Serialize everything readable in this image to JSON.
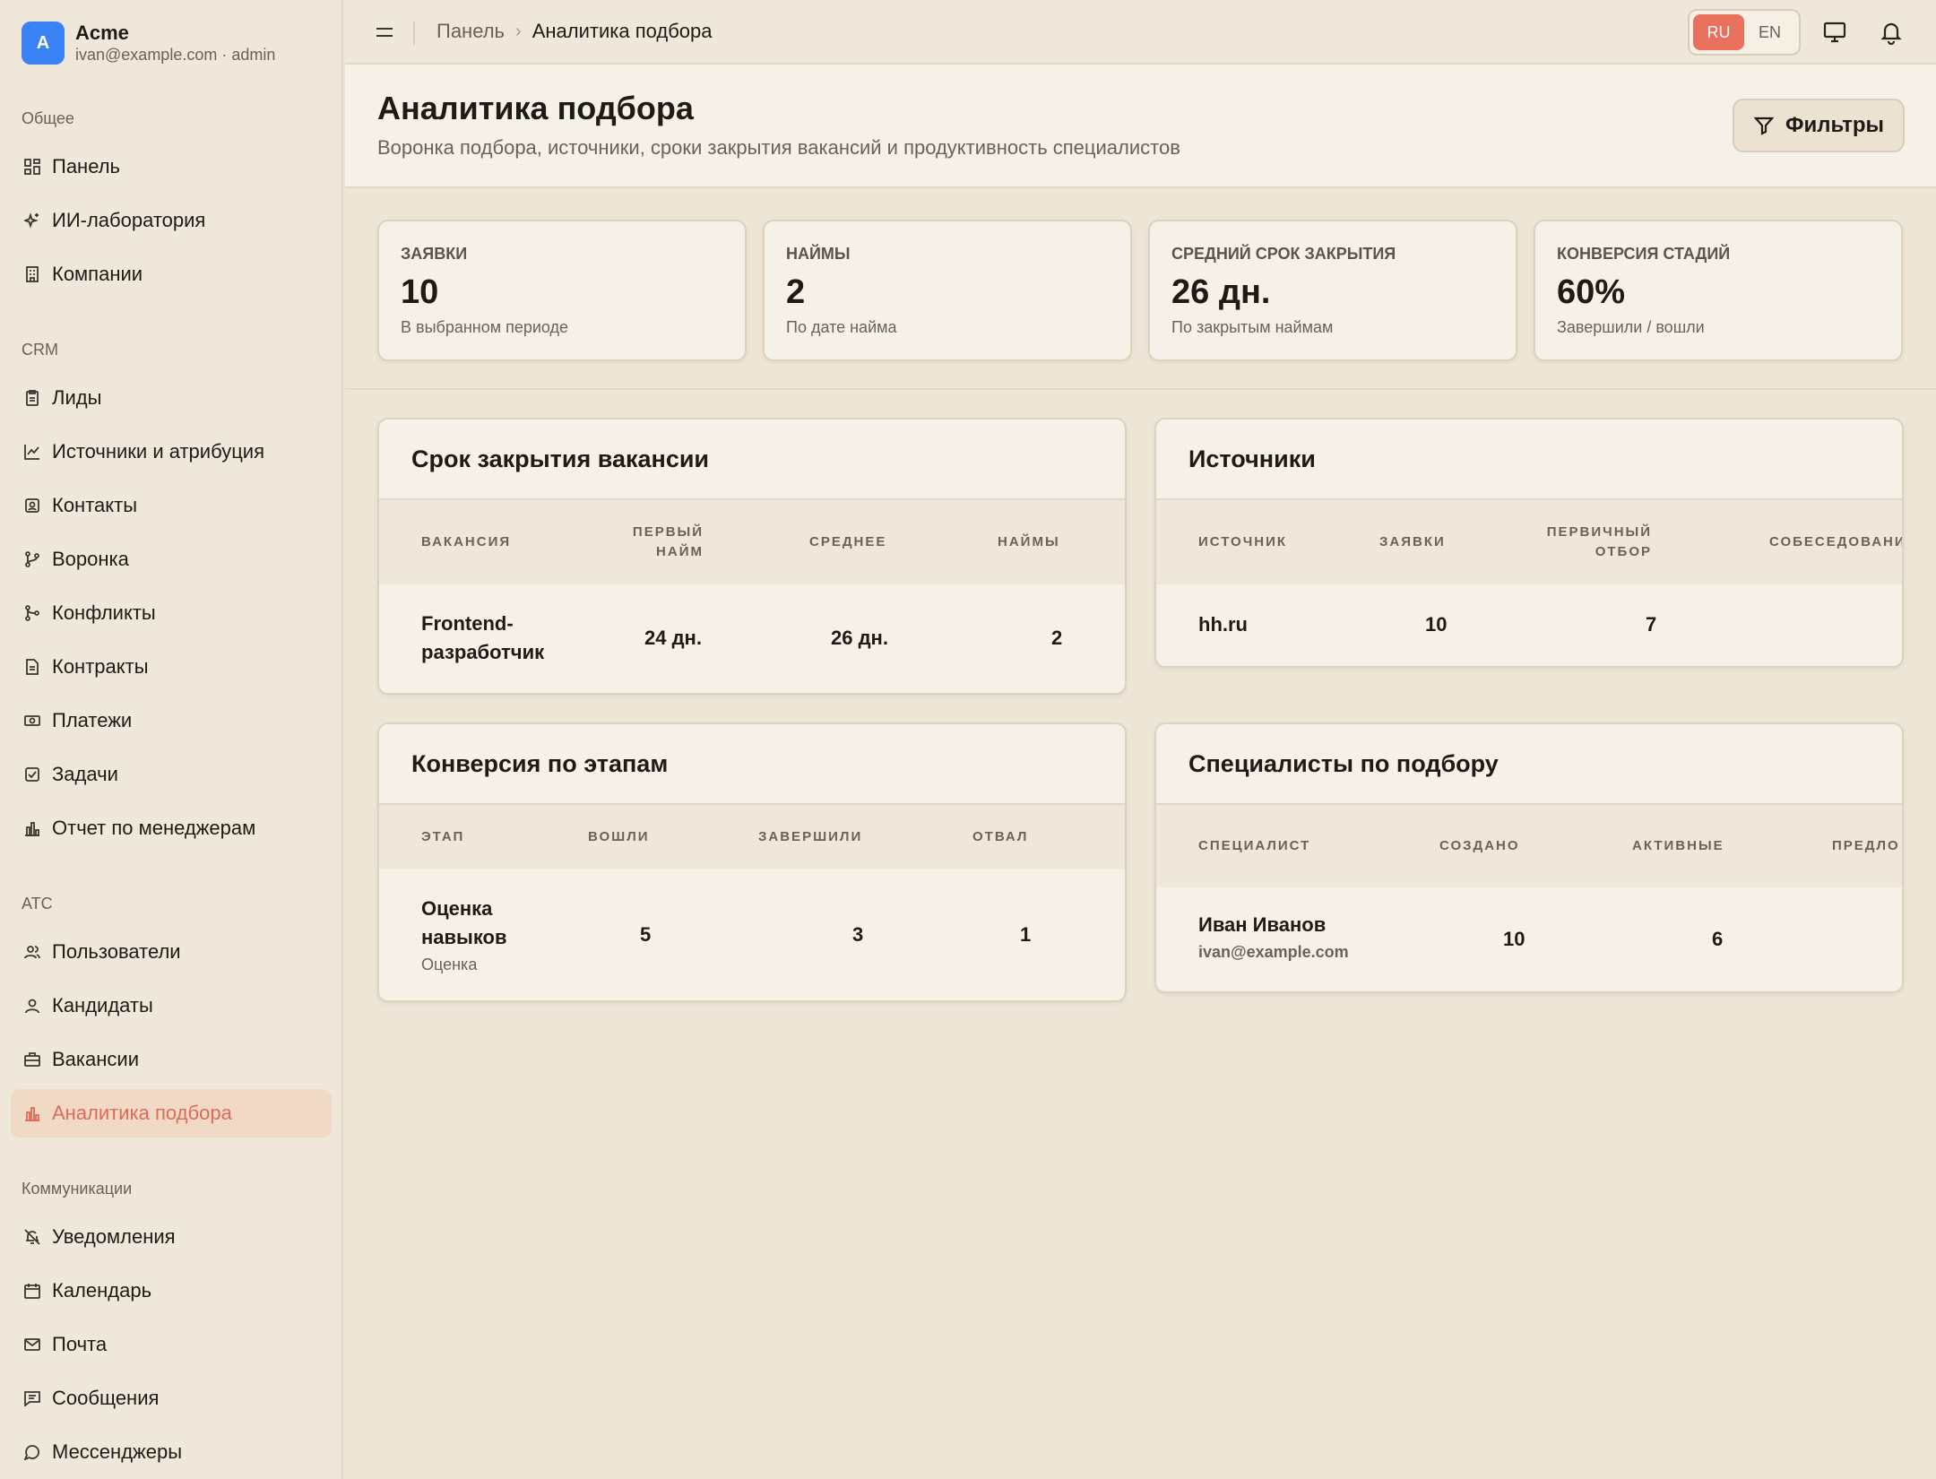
{
  "brand": {
    "initial": "A",
    "name": "Acme",
    "sub": "ivan@example.com · admin"
  },
  "sidebar": {
    "sections": [
      {
        "title": "Общее",
        "items": [
          {
            "label": "Панель",
            "icon": "dashboard-icon"
          },
          {
            "label": "ИИ-лаборатория",
            "icon": "sparkles-icon"
          },
          {
            "label": "Компании",
            "icon": "building-icon"
          }
        ]
      },
      {
        "title": "CRM",
        "items": [
          {
            "label": "Лиды",
            "icon": "clipboard-icon"
          },
          {
            "label": "Источники и атрибуция",
            "icon": "chart-line-icon"
          },
          {
            "label": "Контакты",
            "icon": "contact-icon"
          },
          {
            "label": "Воронка",
            "icon": "git-branch-icon"
          },
          {
            "label": "Конфликты",
            "icon": "git-merge-icon"
          },
          {
            "label": "Контракты",
            "icon": "file-icon"
          },
          {
            "label": "Платежи",
            "icon": "banknote-icon"
          },
          {
            "label": "Задачи",
            "icon": "check-square-icon"
          },
          {
            "label": "Отчет по менеджерам",
            "icon": "bar-chart-icon"
          }
        ]
      },
      {
        "title": "ATC",
        "items": [
          {
            "label": "Пользователи",
            "icon": "users-icon"
          },
          {
            "label": "Кандидаты",
            "icon": "user-icon"
          },
          {
            "label": "Вакансии",
            "icon": "briefcase-icon"
          },
          {
            "label": "Аналитика подбора",
            "icon": "bar-chart-icon",
            "active": true
          }
        ]
      },
      {
        "title": "Коммуникации",
        "items": [
          {
            "label": "Уведомления",
            "icon": "bell-off-icon"
          },
          {
            "label": "Календарь",
            "icon": "calendar-icon"
          },
          {
            "label": "Почта",
            "icon": "mail-icon"
          },
          {
            "label": "Сообщения",
            "icon": "message-square-icon"
          },
          {
            "label": "Мессенджеры",
            "icon": "message-circle-icon"
          }
        ]
      }
    ]
  },
  "topbar": {
    "breadcrumb_home": "Панель",
    "breadcrumb_sep": "›",
    "breadcrumb_current": "Аналитика подбора",
    "lang_ru": "RU",
    "lang_en": "EN"
  },
  "header": {
    "title": "Аналитика подбора",
    "subtitle": "Воронка подбора, источники, сроки закрытия вакансий и продуктивность специалистов",
    "filters_label": "Фильтры"
  },
  "kpis": [
    {
      "label": "ЗАЯВКИ",
      "value": "10",
      "note": "В выбранном периоде"
    },
    {
      "label": "НАЙМЫ",
      "value": "2",
      "note": "По дате найма"
    },
    {
      "label": "СРЕДНИЙ СРОК ЗАКРЫТИЯ",
      "value": "26 дн.",
      "note": "По закрытым наймам"
    },
    {
      "label": "КОНВЕРСИЯ СТАДИЙ",
      "value": "60%",
      "note": "Завершили / вошли"
    }
  ],
  "closing": {
    "title": "Срок закрытия вакансии",
    "headers": [
      "ВАКАНСИЯ",
      "ПЕРВЫЙ\nНАЙМ",
      "СРЕДНЕЕ",
      "НАЙМЫ"
    ],
    "row": {
      "vacancy_1": "Frontend-",
      "vacancy_2": "разработчик",
      "first": "24 дн.",
      "avg": "26 дн.",
      "hires": "2"
    }
  },
  "sources": {
    "title": "Источники",
    "headers": [
      "ИСТОЧНИК",
      "ЗАЯВКИ",
      "ПЕРВИЧНЫЙ\nОТБОР",
      "СОБЕСЕДОВАНИ"
    ],
    "row": {
      "source": "hh.ru",
      "applications": "10",
      "screening": "7"
    }
  },
  "conversion": {
    "title": "Конверсия по этапам",
    "headers": [
      "ЭТАП",
      "ВОШЛИ",
      "ЗАВЕРШИЛИ",
      "ОТВАЛ"
    ],
    "row": {
      "stage_1": "Оценка",
      "stage_2": "навыков",
      "stage_sub": "Оценка",
      "entered": "5",
      "completed": "3",
      "dropped": "1"
    }
  },
  "specialists": {
    "title": "Специалисты по подбору",
    "headers": [
      "СПЕЦИАЛИСТ",
      "СОЗДАНО",
      "АКТИВНЫЕ",
      "ПРЕДЛО"
    ],
    "row": {
      "name": "Иван Иванов",
      "email": "ivan@example.com",
      "created": "10",
      "active": "6"
    }
  }
}
